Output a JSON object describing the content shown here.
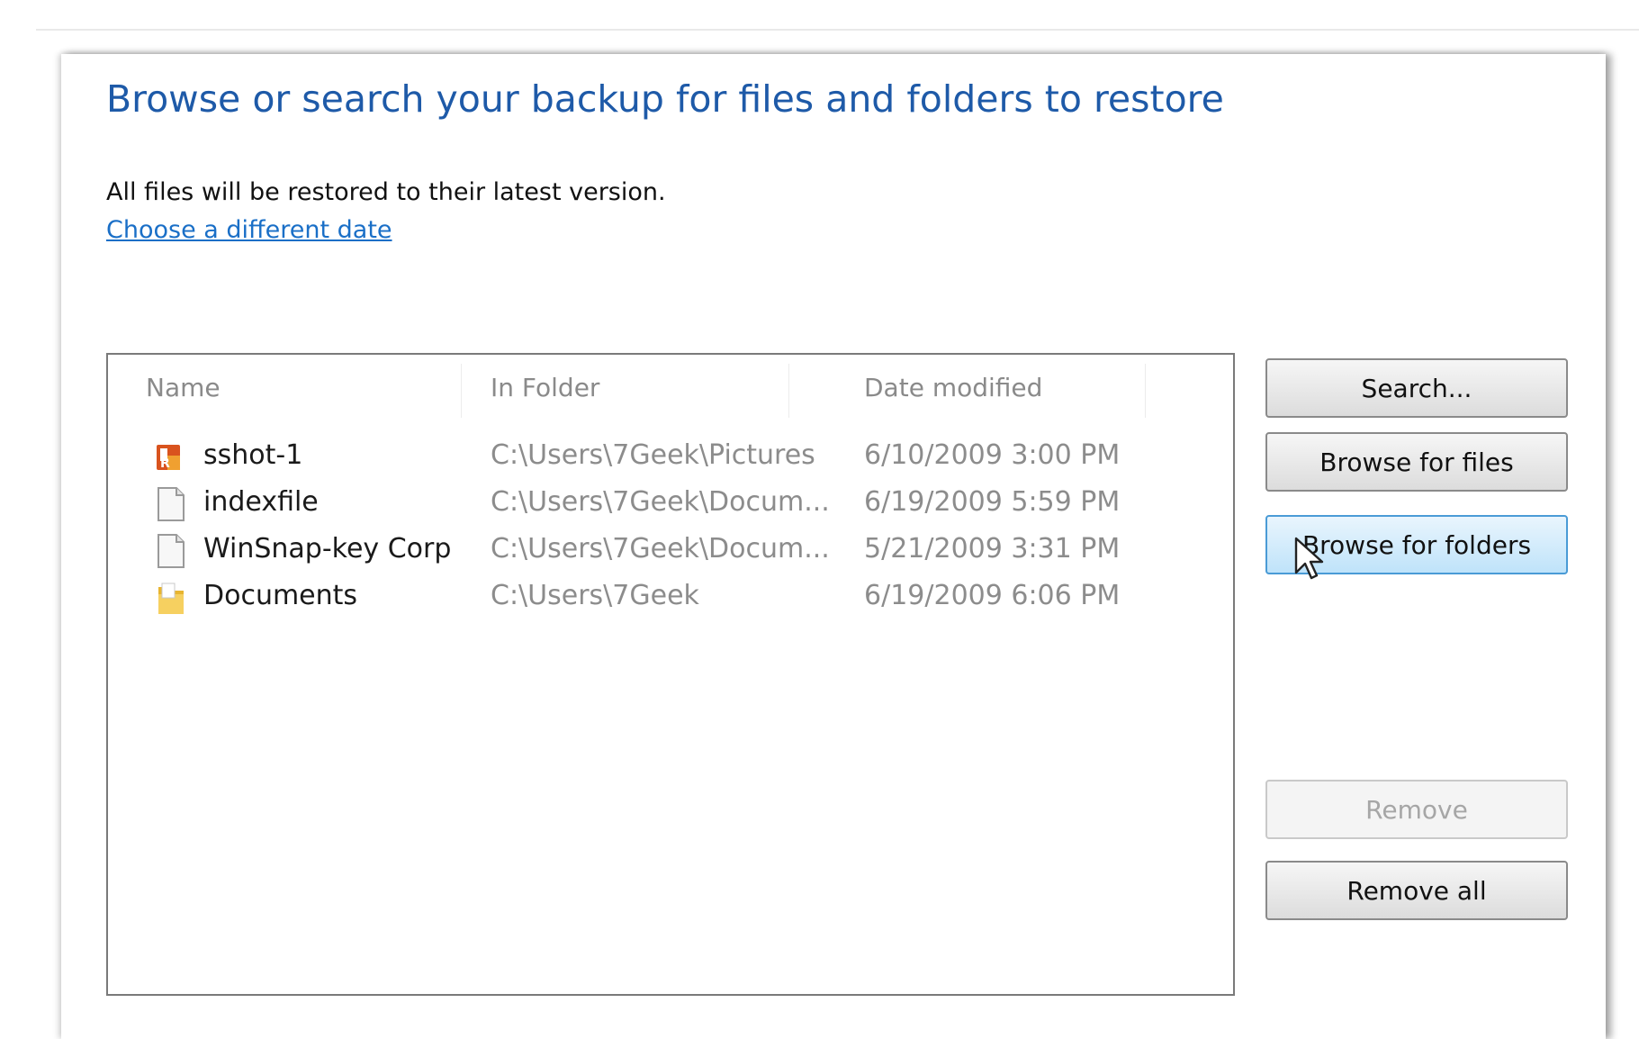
{
  "dialog": {
    "heading": "Browse or search your backup for files and folders to restore",
    "info_text": "All files will be restored to their latest version.",
    "date_link": "Choose a different date"
  },
  "file_list": {
    "columns": [
      "Name",
      "In Folder",
      "Date modified"
    ],
    "rows": [
      {
        "name": "sshot-1",
        "folder": "C:\\Users\\7Geek\\Pictures",
        "date": "6/10/2009 3:00 PM",
        "icon": "image-file-icon"
      },
      {
        "name": "indexfile",
        "folder": "C:\\Users\\7Geek\\Docum...",
        "date": "6/19/2009 5:59 PM",
        "icon": "document-file-icon"
      },
      {
        "name": "WinSnap-key Corp",
        "folder": "C:\\Users\\7Geek\\Docum...",
        "date": "5/21/2009 3:31 PM",
        "icon": "document-file-icon"
      },
      {
        "name": "Documents",
        "folder": "C:\\Users\\7Geek",
        "date": "6/19/2009 6:06 PM",
        "icon": "folder-icon"
      }
    ]
  },
  "buttons": {
    "search": "Search...",
    "browse_files": "Browse for files",
    "browse_folders": "Browse for folders",
    "remove": "Remove",
    "remove_all": "Remove all"
  },
  "colors": {
    "heading": "#1e5aa8",
    "link": "#1a6fc7",
    "hover_button": "#bfe3fa"
  }
}
